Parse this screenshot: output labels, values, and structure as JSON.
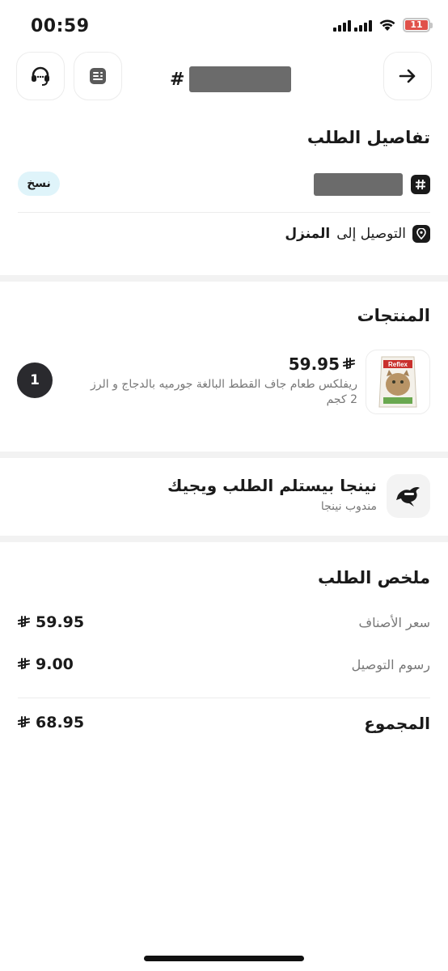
{
  "status_bar": {
    "time": "00:59",
    "battery_level": "11",
    "battery_color": "#e0514a"
  },
  "header": {
    "hash": "#",
    "support_icon": "headset-icon",
    "receipt_icon": "receipt-icon",
    "back_icon": "arrow-right-icon"
  },
  "order_details": {
    "title": "تفاصيل الطلب",
    "copy_label": "نسخ",
    "delivery_prefix": "التوصيل إلى",
    "delivery_place": "المنزل",
    "copy_chip_color": "#dff4fa"
  },
  "products": {
    "title": "المنتجات",
    "items": [
      {
        "price": "59.95",
        "name": "ريفلكس طعام جاف القطط البالغة جورميه بالدجاج و الرز 2 كجم",
        "quantity": "1"
      }
    ]
  },
  "courier": {
    "title": "نينجا بيستلم الطلب ويجيك",
    "subtitle": "مندوب نينجا"
  },
  "summary": {
    "title": "ملخص الطلب",
    "items_price_label": "سعر الأصناف",
    "items_price_value": "59.95",
    "delivery_fee_label": "رسوم التوصيل",
    "delivery_fee_value": "9.00",
    "total_label": "المجموع",
    "total_value": "68.95"
  }
}
